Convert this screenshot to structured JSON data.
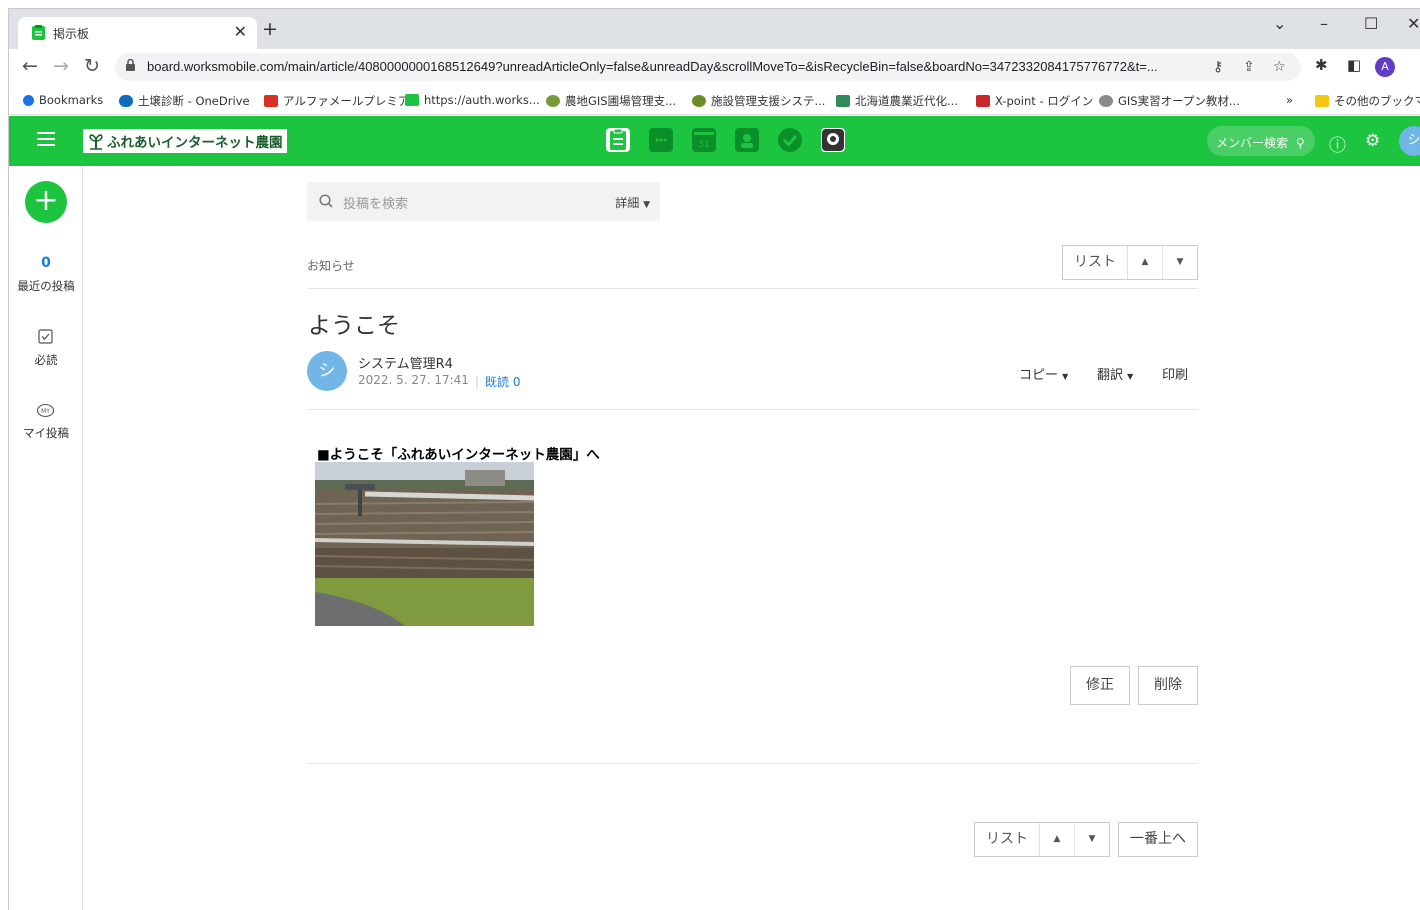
{
  "browser": {
    "tab_title": "掲示板",
    "url": "board.worksmobile.com/main/article/4080000000168512649?unreadArticleOnly=false&unreadDay&scrollMoveTo=&isRecycleBin=false&boardNo=347233208417577677​2&t=...",
    "profile_initial": "A"
  },
  "bookmarks": [
    {
      "label": "Bookmarks",
      "color": "#1a73e8"
    },
    {
      "label": "土壌診断 - OneDrive",
      "color": "#0f6cbd"
    },
    {
      "label": "アルファメールプレミア...",
      "color": "#d93025"
    },
    {
      "label": "https://auth.works...",
      "color": "#1cc43f"
    },
    {
      "label": "農地GIS圃場管理支...",
      "color": "#7a9a3a"
    },
    {
      "label": "施設管理支援システ...",
      "color": "#6b8e23"
    },
    {
      "label": "北海道農業近代化...",
      "color": "#2e8b57"
    },
    {
      "label": "X-point - ログイン",
      "color": "#c62828"
    },
    {
      "label": "GIS実習オープン教材...",
      "color": "#8a8a8a"
    }
  ],
  "bookmarks_more": "»",
  "bookmarks_other": "その他のブックマーク",
  "app": {
    "logo_text": "ふれあいインターネット農園",
    "member_search": "メンバー検索",
    "user_initial": "シ"
  },
  "sidebar": {
    "recent_count": "0",
    "recent_label": "最近の投稿",
    "required_label": "必読",
    "my_posts_label": "マイ投稿"
  },
  "search": {
    "placeholder": "投稿を検索",
    "detail": "詳細"
  },
  "article": {
    "category": "お知らせ",
    "title": "ようこそ",
    "author": "システム管理R4",
    "date": "2022. 5. 27. 17:41",
    "read": "既読 0",
    "actions": {
      "copy": "コピー",
      "translate": "翻訳",
      "print": "印刷"
    },
    "body_heading": "■ようこそ「ふれあいインターネット農園」へ",
    "edit": "修正",
    "delete": "削除"
  },
  "nav": {
    "list": "リスト",
    "to_top": "一番上へ"
  }
}
